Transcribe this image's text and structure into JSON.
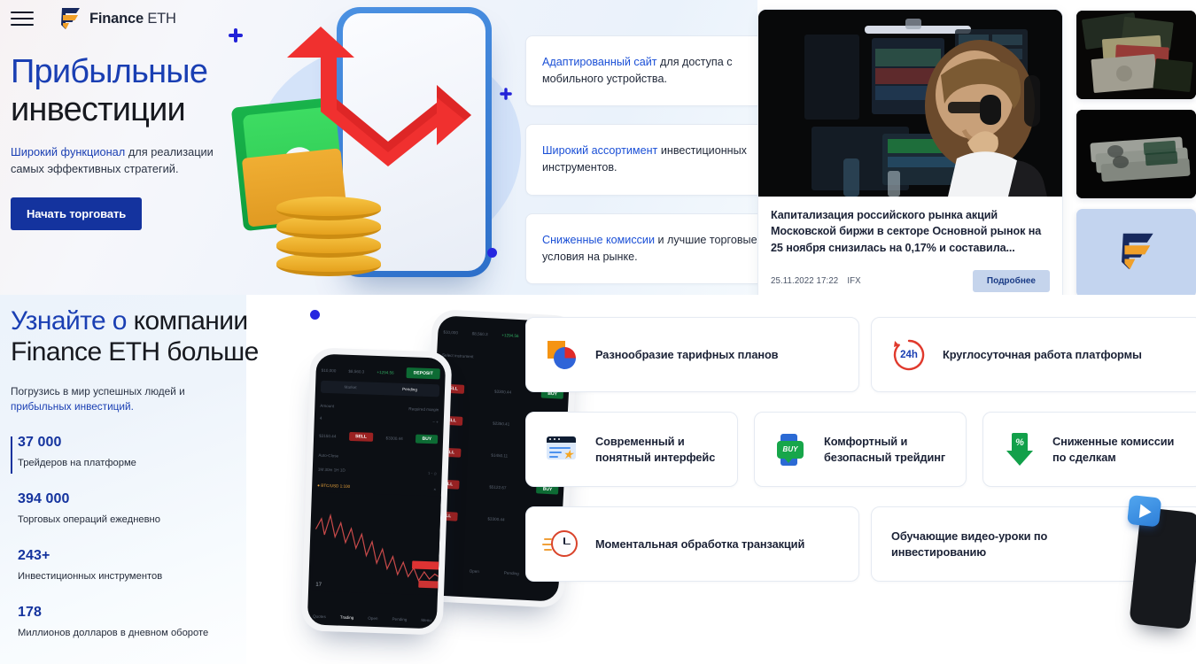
{
  "header": {
    "menu_icon": "hamburger-menu-icon",
    "logo_icon": "finance-eth-logo-icon",
    "brand_bold": "Finance",
    "brand_light": "ETH"
  },
  "hero": {
    "title_line1": "Прибыльные",
    "title_line2": "инвестиции",
    "subtitle_highlight": "Широкий функционал",
    "subtitle_rest": " для реализации самых эффективных стратегий.",
    "cta_label": "Начать торговать"
  },
  "top_features": [
    {
      "highlight": "Адаптированный сайт",
      "rest": " для доступа с мобильного устройства."
    },
    {
      "highlight": "Широкий ассортимент",
      "rest": " инвестиционных инструментов."
    },
    {
      "highlight": "Сниженные комиссии",
      "rest": " и лучшие торговые условия на рынке."
    }
  ],
  "news": {
    "image_alt": "trader-at-desk-photo",
    "title": "Капитализация российского рынка акций Московской биржи в секторе Основной рынок на 25 ноября снизилась на 0,17% и составила...",
    "date": "25.11.2022 17:22",
    "source": "IFX",
    "button_label": "Подробнее"
  },
  "thumbnails": [
    {
      "name": "banknotes-photo"
    },
    {
      "name": "dollar-bills-photo"
    },
    {
      "name": "finance-eth-logo-tile"
    }
  ],
  "about": {
    "title_part1": "Узнайте о",
    "title_part2": "компании Finance",
    "title_part3": "ETH больше",
    "subtitle_plain": "Погрузись в мир успешных людей и ",
    "subtitle_highlight": "прибыльных инвестиций.",
    "stats": [
      {
        "number": "37 000",
        "label": "Трейдеров на платформе"
      },
      {
        "number": "394 000",
        "label": "Торговых операций ежедневно"
      },
      {
        "number": "243+",
        "label": "Инвестиционных инструментов"
      },
      {
        "number": "178",
        "label": "Миллионов долларов в дневном обороте"
      }
    ]
  },
  "bottom_features": [
    {
      "icon": "pie-chart-icon",
      "label": "Разнообразие тарифных планов"
    },
    {
      "icon": "24h-clock-icon",
      "label": "Круглосуточная работа платформы"
    },
    {
      "icon": "interface-star-icon",
      "label": "Современный и понятный интерфейс"
    },
    {
      "icon": "buy-phone-icon",
      "label": "Комфортный и безопасный трейдинг"
    },
    {
      "icon": "percent-arrow-down-icon",
      "label": "Сниженные комиссии по сделкам"
    },
    {
      "icon": "stopwatch-icon",
      "label": "Моментальная обработка транзакций"
    },
    {
      "icon": "video-phone-icon",
      "label": "Обучающие видео-уроки по инвестированию"
    }
  ],
  "app_mockup": {
    "deposit_label": "DEPOSIT",
    "tab_market": "Market",
    "tab_pending": "Pending",
    "amount_label": "Amount",
    "sell_label": "SELL",
    "buy_label": "BUY",
    "autoclose_label": "Auto-Close",
    "pair": "BTC/USD",
    "balance": "$10,000",
    "equity": "$8,560.3"
  },
  "icon_24h_text": "24h",
  "icon_buy_text": "BUY",
  "icon_percent_text": "%",
  "colors": {
    "brand_blue": "#14339e",
    "heading_blue": "#1a3fb3",
    "link_blue": "#1a4fd6",
    "dark": "#17191f",
    "news_btn_bg": "#c5d4ec",
    "green": "#17a64a",
    "red": "#e0392c",
    "orange": "#f59412"
  }
}
